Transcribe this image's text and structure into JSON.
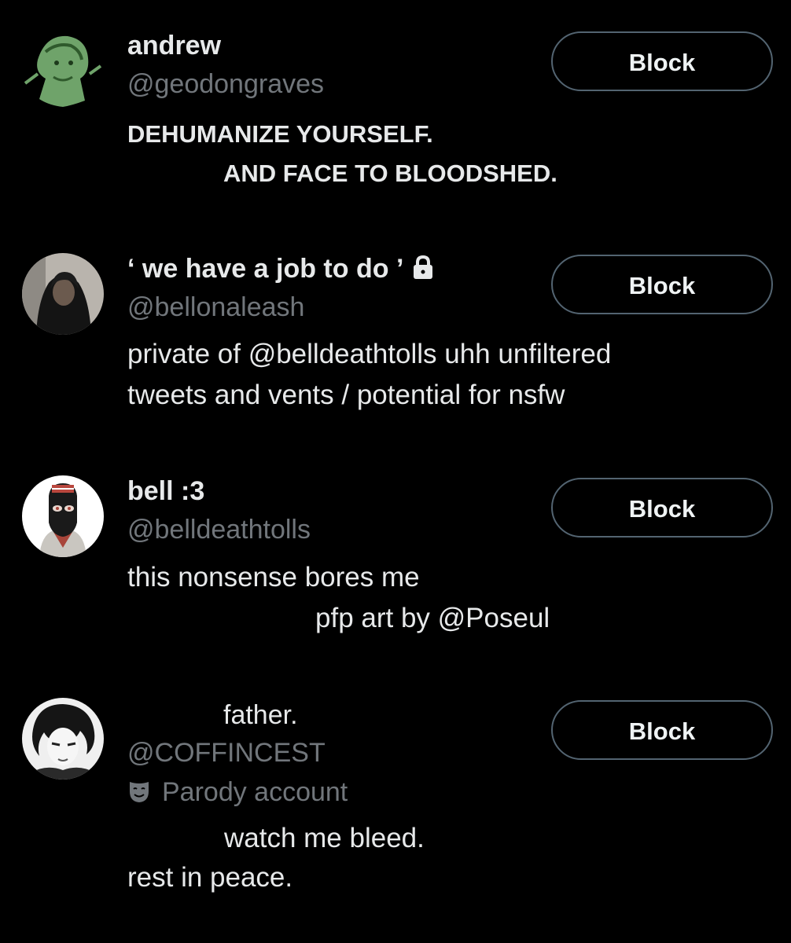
{
  "block_label": "Block",
  "users": [
    {
      "display_name": "andrew",
      "handle": "@geodongraves",
      "bio": [
        "DEHUMANIZE YOURSELF.",
        "AND FACE TO BLOODSHED."
      ],
      "avatar": "green-anime-character-avatar"
    },
    {
      "display_name": "‘ we have a job to do ’",
      "handle": "@bellonaleash",
      "protected": true,
      "bio": [
        "private of @belldeathtolls uhh unfiltered",
        "tweets and vents / potential for nsfw"
      ],
      "avatar": "hooded-person-photo-avatar"
    },
    {
      "display_name": "bell :3",
      "handle": "@belldeathtolls",
      "bio": [
        "this nonsense bores me",
        "pfp art by @Poseul"
      ],
      "avatar": "masked-character-avatar"
    },
    {
      "display_name": "father.",
      "handle": "@COFFINCEST",
      "label": "Parody account",
      "bio": [
        "watch me bleed.",
        "rest in peace."
      ],
      "avatar": "monochrome-manga-avatar"
    }
  ],
  "colors": {
    "background": "#000000",
    "primary_text": "#e7e9ea",
    "secondary_text": "#71767b",
    "button_border": "#536471"
  }
}
